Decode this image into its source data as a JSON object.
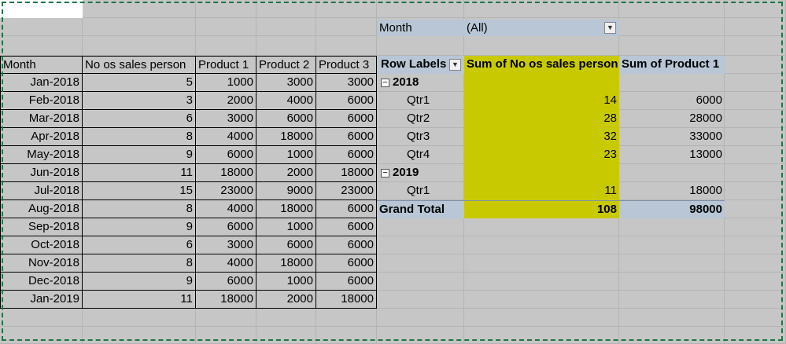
{
  "cell_a1": "",
  "left_table": {
    "headers": [
      "Month",
      "No os sales person",
      "Product 1",
      "Product 2",
      "Product 3"
    ],
    "rows": [
      [
        "Jan-2018",
        "5",
        "1000",
        "3000",
        "3000"
      ],
      [
        "Feb-2018",
        "3",
        "2000",
        "4000",
        "6000"
      ],
      [
        "Mar-2018",
        "6",
        "3000",
        "6000",
        "6000"
      ],
      [
        "Apr-2018",
        "8",
        "4000",
        "18000",
        "6000"
      ],
      [
        "May-2018",
        "9",
        "6000",
        "1000",
        "6000"
      ],
      [
        "Jun-2018",
        "11",
        "18000",
        "2000",
        "18000"
      ],
      [
        "Jul-2018",
        "15",
        "23000",
        "9000",
        "23000"
      ],
      [
        "Aug-2018",
        "8",
        "4000",
        "18000",
        "6000"
      ],
      [
        "Sep-2018",
        "9",
        "6000",
        "1000",
        "6000"
      ],
      [
        "Oct-2018",
        "6",
        "3000",
        "6000",
        "6000"
      ],
      [
        "Nov-2018",
        "8",
        "4000",
        "18000",
        "6000"
      ],
      [
        "Dec-2018",
        "9",
        "6000",
        "1000",
        "6000"
      ],
      [
        "Jan-2019",
        "11",
        "18000",
        "2000",
        "18000"
      ]
    ]
  },
  "pivot": {
    "filter_label": "Month",
    "filter_value": "(All)",
    "headers": [
      "Row Labels",
      "Sum of No os sales person",
      "Sum of Product 1"
    ],
    "rows": [
      {
        "label": "2018",
        "type": "year",
        "v1": "",
        "v2": ""
      },
      {
        "label": "Qtr1",
        "type": "qtr",
        "v1": "14",
        "v2": "6000"
      },
      {
        "label": "Qtr2",
        "type": "qtr",
        "v1": "28",
        "v2": "28000"
      },
      {
        "label": "Qtr3",
        "type": "qtr",
        "v1": "32",
        "v2": "33000"
      },
      {
        "label": "Qtr4",
        "type": "qtr",
        "v1": "23",
        "v2": "13000"
      },
      {
        "label": "2019",
        "type": "year",
        "v1": "",
        "v2": ""
      },
      {
        "label": "Qtr1",
        "type": "qtr",
        "v1": "11",
        "v2": "18000"
      }
    ],
    "grand_total": {
      "label": "Grand Total",
      "v1": "108",
      "v2": "98000"
    }
  },
  "colors": {
    "highlight": "#c9c900",
    "pivot_header": "#b8c6d5",
    "selection_border": "#217346",
    "sheet_background": "#c6c6c6"
  },
  "icons": {
    "dropdown": "chevron-down-icon",
    "collapse": "collapse-minus-icon"
  }
}
